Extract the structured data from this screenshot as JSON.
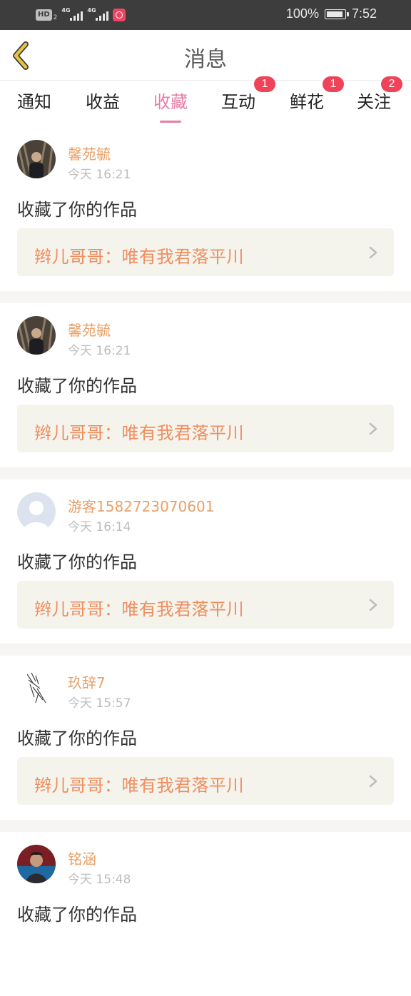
{
  "status_bar": {
    "hd": "HD",
    "hd_sub": "2",
    "net1": "4G",
    "net2": "4G",
    "battery": "100%",
    "time": "7:52"
  },
  "header": {
    "title": "消息"
  },
  "tabs": [
    {
      "label": "通知",
      "badge": ""
    },
    {
      "label": "收益",
      "badge": ""
    },
    {
      "label": "收藏",
      "badge": ""
    },
    {
      "label": "互动",
      "badge": "1"
    },
    {
      "label": "鲜花",
      "badge": "1"
    },
    {
      "label": "关注",
      "badge": "2"
    }
  ],
  "active_tab": "收藏",
  "items": [
    {
      "name": "馨苑毓",
      "time": "今天 16:21",
      "action": "收藏了你的作品",
      "work": "辫儿哥哥：唯有我君落平川"
    },
    {
      "name": "馨苑毓",
      "time": "今天 16:21",
      "action": "收藏了你的作品",
      "work": "辫儿哥哥：唯有我君落平川"
    },
    {
      "name": "游客1582723070601",
      "time": "今天 16:14",
      "action": "收藏了你的作品",
      "work": "辫儿哥哥：唯有我君落平川"
    },
    {
      "name": "玖辞7",
      "time": "今天 15:57",
      "action": "收藏了你的作品",
      "work": "辫儿哥哥：唯有我君落平川"
    },
    {
      "name": "铭涵",
      "time": "今天 15:48",
      "action": "收藏了你的作品",
      "work": ""
    }
  ],
  "colors": {
    "accent": "#e87ca4",
    "username": "#e8a068",
    "work_text": "#f08d5e",
    "badge": "#f0435a",
    "back_arrow": "#e6c341"
  }
}
